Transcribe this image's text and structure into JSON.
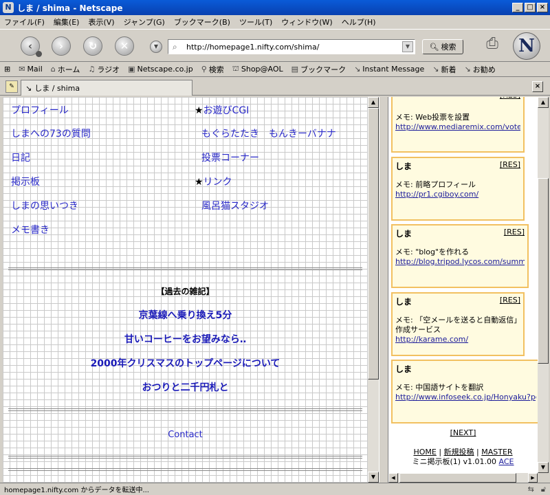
{
  "window": {
    "title": "しま / shima - Netscape",
    "app_icon": "N"
  },
  "menu": [
    "ファイル(F)",
    "編集(E)",
    "表示(V)",
    "ジャンプ(G)",
    "ブックマーク(B)",
    "ツール(T)",
    "ウィンドウ(W)",
    "ヘルプ(H)"
  ],
  "nav": {
    "url": "http://homepage1.nifty.com/shima/",
    "search_label": "検索"
  },
  "personal_toolbar": [
    {
      "icon": "mail-icon",
      "label": "Mail"
    },
    {
      "icon": "home-icon",
      "label": "ホーム"
    },
    {
      "icon": "radio-icon",
      "label": "ラジオ"
    },
    {
      "icon": "my-icon",
      "label": "Netscape.co.jp"
    },
    {
      "icon": "search-icon",
      "label": "検索"
    },
    {
      "icon": "shop-icon",
      "label": "Shop@AOL"
    },
    {
      "icon": "bookmark-icon",
      "label": "ブックマーク"
    },
    {
      "icon": "link-icon",
      "label": "Instant Message"
    },
    {
      "icon": "link-icon",
      "label": "新着"
    },
    {
      "icon": "link-icon",
      "label": "お勧め"
    }
  ],
  "tab": {
    "label": "しま / shima"
  },
  "main": {
    "links_left": [
      "プロフィール",
      "しまへの73の質問",
      "日記",
      "掲示板",
      "しまの思いつき",
      "メモ書き"
    ],
    "links_right": [
      {
        "star": "★",
        "label": "お遊びCGI"
      },
      {
        "star": "",
        "label": "もぐらたたき　もんきーバナナ"
      },
      {
        "star": "",
        "label": "投票コーナー"
      },
      {
        "star": "★",
        "label": "リンク"
      },
      {
        "star": "",
        "label": "風呂猫スタジオ"
      }
    ],
    "section_title": "【過去の雑記】",
    "old_articles": [
      "京葉線へ乗り換え5分",
      "甘いコーヒーをお望みなら‥",
      "2000年クリスマスのトップページについて",
      "おつりと二千円札と"
    ],
    "contact": "Contact"
  },
  "board": {
    "res_label": "[RES]",
    "posts": [
      {
        "name": "",
        "memo": "メモ: Web投票を設置",
        "url": "http://www.mediaremix.com/vote/"
      },
      {
        "name": "しま",
        "memo": "メモ: 前略プロフィール",
        "url": "http://pr1.cgiboy.com/"
      },
      {
        "name": "しま",
        "memo": "メモ: \"blog\"を作れる",
        "url": "http://blog.tripod.lycos.com/summer/"
      },
      {
        "name": "しま",
        "memo": "メモ: 「空メールを送ると自動返信」作成サービス",
        "url": "http://karame.com/"
      },
      {
        "name": "しま",
        "memo": "メモ: 中国語サイトを翻訳",
        "url": "http://www.infoseek.co.jp/Honyaku?pg=h"
      }
    ],
    "next_label": "[NEXT]",
    "footer_home": "HOME",
    "footer_new": "新規投稿",
    "footer_master": "MASTER",
    "footer_version": "ミニ掲示板(1) v1.01.00",
    "footer_ace": "ACE"
  },
  "status": {
    "text": "homepage1.nifty.com からデータを転送中..."
  }
}
